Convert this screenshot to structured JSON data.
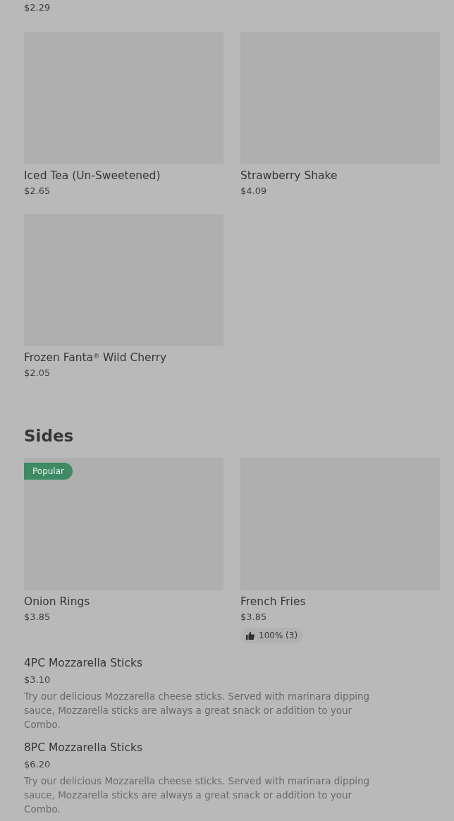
{
  "top_item": {
    "price": "$2.29"
  },
  "drinks": [
    {
      "name": "Iced Tea (Un-Sweetened)",
      "price": "$2.65"
    },
    {
      "name": "Strawberry Shake",
      "price": "$4.09"
    },
    {
      "name": "Frozen Fanta$^{®}$ Wild Cherry",
      "price": "$2.05"
    }
  ],
  "sides": {
    "title": "Sides",
    "grid_items": [
      {
        "name": "Onion Rings",
        "price": "$3.85",
        "badge": "Popular"
      },
      {
        "name": "French Fries",
        "price": "$3.85",
        "rating": "100% (3)"
      }
    ],
    "list_items": [
      {
        "name": "4PC Mozzarella Sticks",
        "price": "$3.10",
        "description": "Try our delicious Mozzarella cheese sticks. Served with marinara dipping sauce, Mozzarella sticks are always a great snack or addition to your Combo."
      },
      {
        "name": "8PC Mozzarella Sticks",
        "price": "$6.20",
        "description": "Try our delicious Mozzarella cheese sticks. Served with marinara dipping sauce, Mozzarella sticks are always a great snack or addition to your Combo."
      }
    ]
  }
}
